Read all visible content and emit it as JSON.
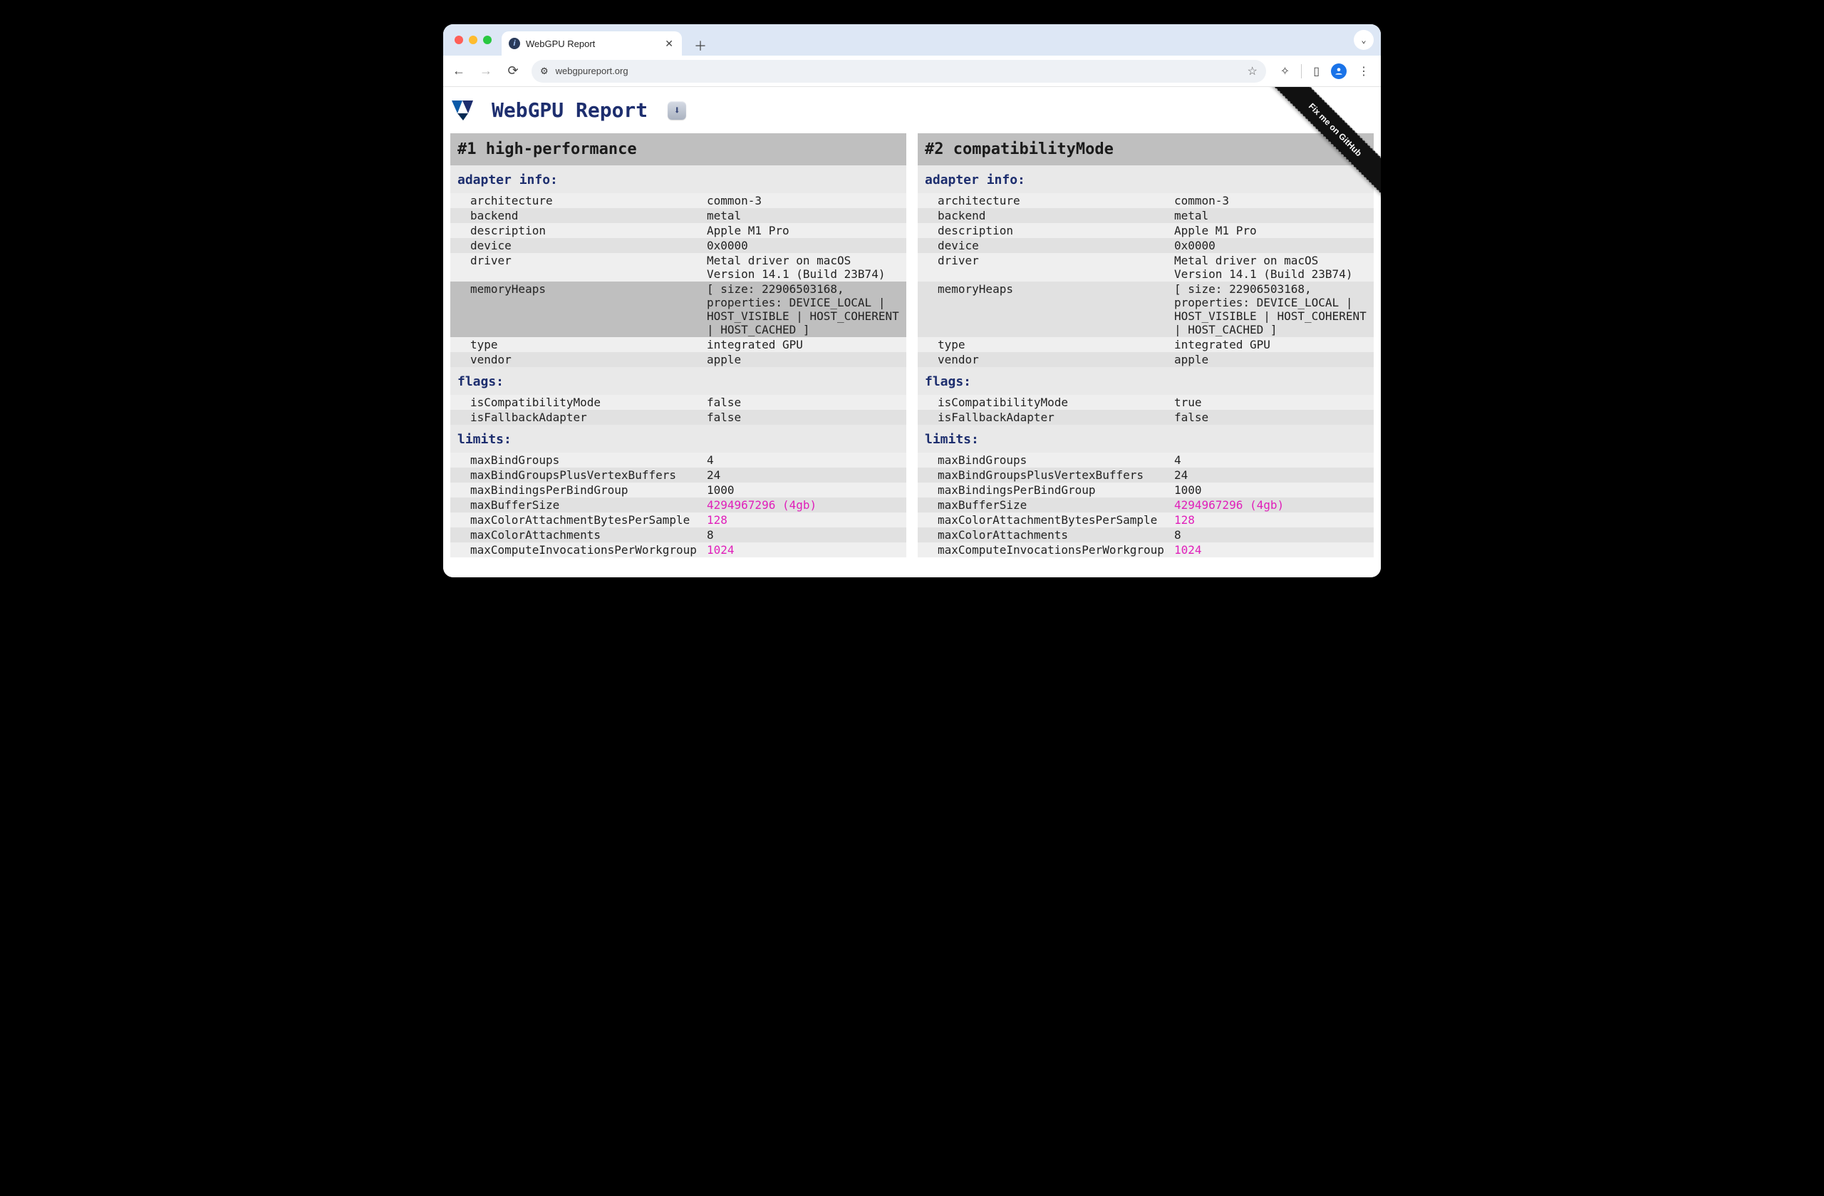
{
  "browser": {
    "tab_title": "WebGPU Report",
    "url": "webgpureport.org"
  },
  "page_title": "WebGPU Report",
  "ribbon": "Fix me on GitHub",
  "sections": [
    "adapter info:",
    "flags:",
    "limits:"
  ],
  "limits_pink_keys": [
    "maxBufferSize",
    "maxColorAttachmentBytesPerSample",
    "maxComputeInvocationsPerWorkgroup"
  ],
  "adapters": [
    {
      "header": "#1 high-performance",
      "highlight_key": "memoryHeaps",
      "adapter_info": [
        [
          "architecture",
          "common-3"
        ],
        [
          "backend",
          "metal"
        ],
        [
          "description",
          "Apple M1 Pro"
        ],
        [
          "device",
          "0x0000"
        ],
        [
          "driver",
          "Metal driver on macOS Version 14.1 (Build 23B74)"
        ],
        [
          "memoryHeaps",
          "[ size: 22906503168, properties: DEVICE_LOCAL | HOST_VISIBLE | HOST_COHERENT | HOST_CACHED ]"
        ],
        [
          "type",
          "integrated GPU"
        ],
        [
          "vendor",
          "apple"
        ]
      ],
      "flags": [
        [
          "isCompatibilityMode",
          "false"
        ],
        [
          "isFallbackAdapter",
          "false"
        ]
      ],
      "limits": [
        [
          "maxBindGroups",
          "4"
        ],
        [
          "maxBindGroupsPlusVertexBuffers",
          "24"
        ],
        [
          "maxBindingsPerBindGroup",
          "1000"
        ],
        [
          "maxBufferSize",
          "4294967296 (4gb)"
        ],
        [
          "maxColorAttachmentBytesPerSample",
          "128"
        ],
        [
          "maxColorAttachments",
          "8"
        ],
        [
          "maxComputeInvocationsPerWorkgroup",
          "1024"
        ]
      ]
    },
    {
      "header": "#2 compatibilityMode",
      "highlight_key": null,
      "adapter_info": [
        [
          "architecture",
          "common-3"
        ],
        [
          "backend",
          "metal"
        ],
        [
          "description",
          "Apple M1 Pro"
        ],
        [
          "device",
          "0x0000"
        ],
        [
          "driver",
          "Metal driver on macOS Version 14.1 (Build 23B74)"
        ],
        [
          "memoryHeaps",
          "[ size: 22906503168, properties: DEVICE_LOCAL | HOST_VISIBLE | HOST_COHERENT | HOST_CACHED ]"
        ],
        [
          "type",
          "integrated GPU"
        ],
        [
          "vendor",
          "apple"
        ]
      ],
      "flags": [
        [
          "isCompatibilityMode",
          "true"
        ],
        [
          "isFallbackAdapter",
          "false"
        ]
      ],
      "limits": [
        [
          "maxBindGroups",
          "4"
        ],
        [
          "maxBindGroupsPlusVertexBuffers",
          "24"
        ],
        [
          "maxBindingsPerBindGroup",
          "1000"
        ],
        [
          "maxBufferSize",
          "4294967296 (4gb)"
        ],
        [
          "maxColorAttachmentBytesPerSample",
          "128"
        ],
        [
          "maxColorAttachments",
          "8"
        ],
        [
          "maxComputeInvocationsPerWorkgroup",
          "1024"
        ]
      ]
    }
  ]
}
